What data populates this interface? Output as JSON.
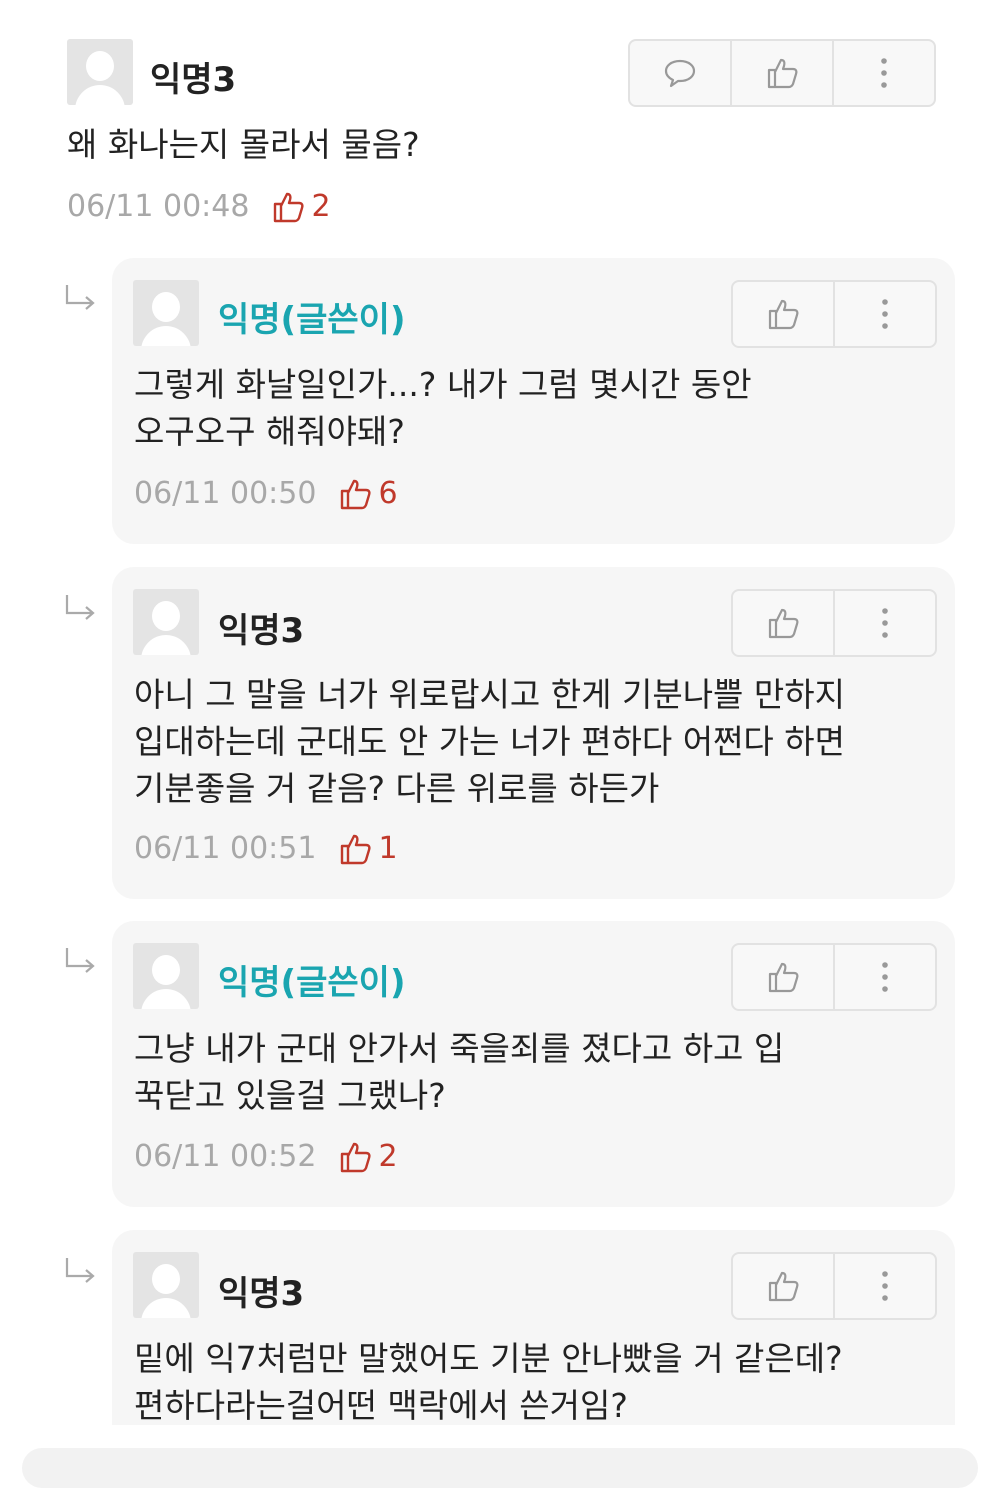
{
  "comments": [
    {
      "name": "익명3",
      "text": "왜 화나는지 몰라서 물음?",
      "time": "06/11 00:48",
      "likes": "2"
    },
    {
      "name": "익명(글쓴이)",
      "text": "그렇게 화날일인가...? 내가 그럼 몇시간 동안\n오구오구 해줘야돼?",
      "time": "06/11 00:50",
      "likes": "6"
    },
    {
      "name": "익명3",
      "text": "아니 그 말을 너가 위로랍시고 한게 기분나쁠 만하지\n입대하는데 군대도 안 가는 너가 편하다 어쩐다 하면\n기분좋을 거 같음? 다른 위로를 하든가",
      "time": "06/11 00:51",
      "likes": "1"
    },
    {
      "name": "익명(글쓴이)",
      "text": "그냥 내가 군대 안가서 죽을죄를 졌다고 하고 입\n꾹닫고 있을걸 그랬나?",
      "time": "06/11 00:52",
      "likes": "2"
    },
    {
      "name": "익명3",
      "text": "밑에 익7처럼만 말했어도 기분 안나빴을 거 같은데?\n편하다라는걸어떤 맥락에서 쓴거임?"
    }
  ],
  "icons": {
    "comment": "speech-bubble-icon",
    "like": "thumbs-up-icon",
    "more": "vertical-dots-icon",
    "reply": "reply-arrow-icon"
  },
  "colors": {
    "author": "#1aa5b0",
    "likes": "#c0392b",
    "meta": "#a8a8a8"
  }
}
